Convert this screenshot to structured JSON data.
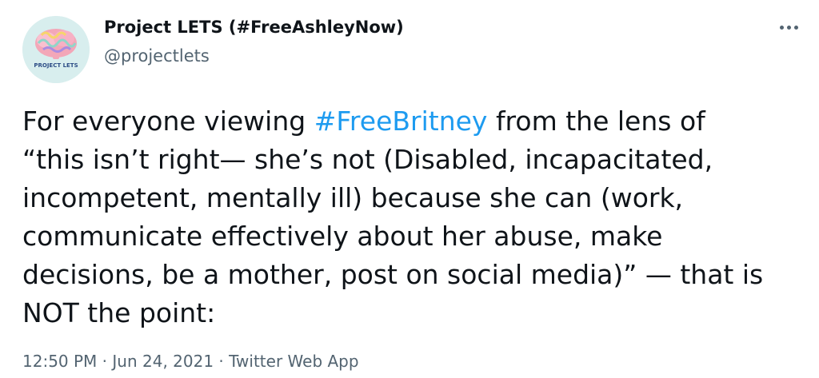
{
  "author": {
    "display_name": "Project LETS (#FreeAshleyNow)",
    "handle": "@projectlets",
    "avatar_text": "PROJECT LETS",
    "avatar_icon": "brain-logo"
  },
  "more_icon": "ellipsis-icon",
  "tweet": {
    "line1_before": "For everyone viewing ",
    "line1_hashtag": "#FreeBritney",
    "line1_after": " from the lens of",
    "line2": "“this isn’t right— she’s not (Disabled, incapacitated,",
    "line3": "incompetent, mentally ill) because she can (work,",
    "line4": "communicate effectively about her abuse, make",
    "line5": "decisions, be a mother, post on social media)” — that is",
    "line6": "NOT the point:"
  },
  "meta": {
    "time": "12:50 PM",
    "sep1": " · ",
    "date": "Jun 24, 2021",
    "sep2": " · ",
    "source": "Twitter Web App"
  },
  "colors": {
    "text": "#0f1419",
    "secondary": "#536471",
    "link": "#1d9bf0"
  }
}
